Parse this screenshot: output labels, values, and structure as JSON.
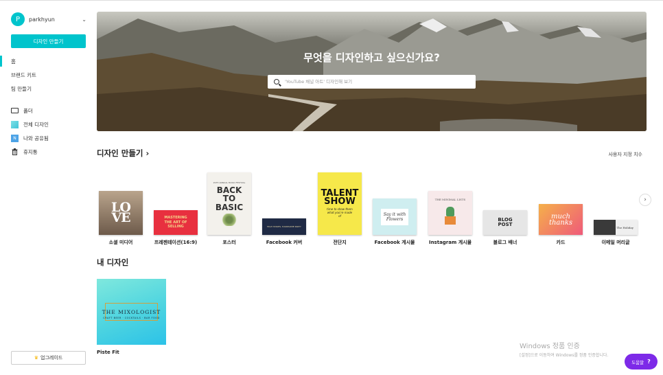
{
  "colors": {
    "accent": "#00c4cc",
    "help": "#7d2ae8"
  },
  "user": {
    "initial": "P",
    "name": "parkhyun"
  },
  "sidebar": {
    "create_label": "디자인 만들기",
    "items": [
      {
        "label": "홈",
        "icon": ""
      },
      {
        "label": "브랜드 키트",
        "icon": ""
      },
      {
        "label": "팀 만들기",
        "icon": ""
      },
      {
        "label": "폴더",
        "icon": "folder-icon"
      },
      {
        "label": "전체 디자인",
        "icon": "all-designs-icon"
      },
      {
        "label": "나와 공유됨",
        "icon": "shared-icon",
        "glyph": "N"
      },
      {
        "label": "휴지통",
        "icon": "trash-icon"
      }
    ],
    "upgrade_label": "업그레이드"
  },
  "hero": {
    "title": "무엇을 디자인하고 싶으신가요?",
    "search_placeholder": "'YouTube 채널 아트' 디자인해 보기"
  },
  "create_section": {
    "title": "디자인 만들기",
    "arrow": "›",
    "custom_size": "사용자 지정 치수",
    "templates": [
      {
        "label": "소셜 미디어",
        "thumb_text": "LOVE"
      },
      {
        "label": "프레젠테이션(16:9)",
        "thumb_text": "MASTERING THE ART OF SELLING"
      },
      {
        "label": "포스터",
        "thumb_text": "BACK TO BASIC",
        "thumb_sub": "29TH ANNUAL MUSIC FESTIVAL"
      },
      {
        "label": "Facebook 커버",
        "thumb_text": "HIGH STAKES, HANDSOME PARTY"
      },
      {
        "label": "전단지",
        "thumb_text": "TALENT SHOW",
        "thumb_sub": "time to show them what you're made of"
      },
      {
        "label": "Facebook 게시물",
        "thumb_text": "Say it with Flowers"
      },
      {
        "label": "Instagram 게시물",
        "thumb_text": "THE MINIMAL LISTS"
      },
      {
        "label": "블로그 배너",
        "thumb_text": "BLOG POST"
      },
      {
        "label": "카드",
        "thumb_text": "much thanks"
      },
      {
        "label": "이메일 머리글",
        "thumb_text": "The Holiday"
      }
    ]
  },
  "my_designs": {
    "title": "내 디자인",
    "items": [
      {
        "name": "Piste Fit",
        "thumb_title": "THE MIXOLOGIST",
        "thumb_sub": "CRAFT BEER · COCKTAILS · BAR FOOD"
      }
    ]
  },
  "windows_notice": {
    "title": "Windows 정품 인증",
    "sub": "[설정]으로 이동하여 Windows를 정품 인증합니다."
  },
  "help": {
    "label": "도움말",
    "glyph": "?"
  },
  "next_glyph": "›"
}
